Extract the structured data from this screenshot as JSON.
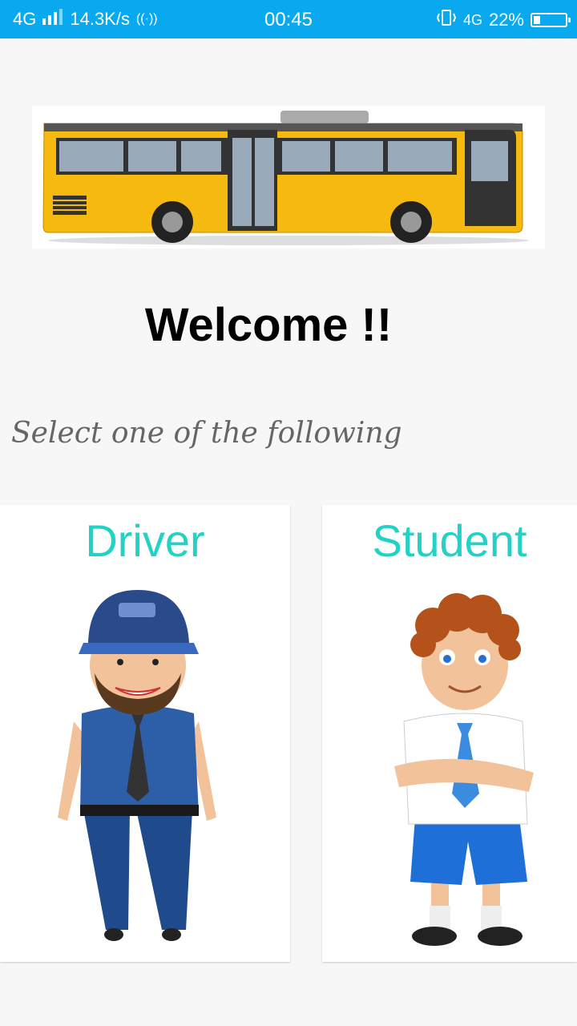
{
  "status_bar": {
    "network": "4G",
    "speed": "14.3K/s",
    "time": "00:45",
    "network_right": "4G",
    "battery": "22%",
    "battery_level": 0.22
  },
  "welcome": "Welcome !!",
  "prompt": "Select one of the following",
  "options": [
    {
      "label": "Driver"
    },
    {
      "label": "Student"
    }
  ],
  "colors": {
    "status_bar": "#08a9ee",
    "option_label": "#22d3c5",
    "bus_yellow": "#f5b90f"
  }
}
